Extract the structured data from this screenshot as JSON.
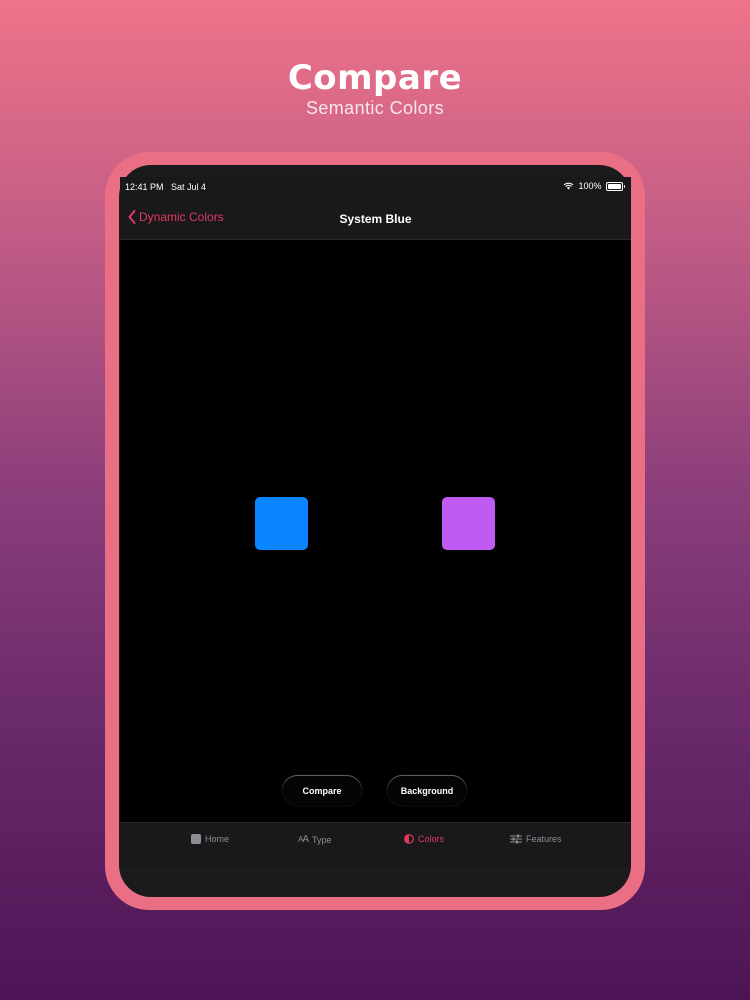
{
  "promo": {
    "title": "Compare",
    "subtitle": "Semantic Colors"
  },
  "status_bar": {
    "time": "12:41 PM",
    "date": "Sat Jul 4",
    "battery": "100%"
  },
  "nav": {
    "back_label": "Dynamic Colors",
    "title": "System Blue"
  },
  "swatches": {
    "left_color": "#0a84ff",
    "right_color": "#bf5af2"
  },
  "buttons": {
    "compare": "Compare",
    "background": "Background"
  },
  "tabs": [
    {
      "label": "Home",
      "icon": "square-icon"
    },
    {
      "label": "Type",
      "icon": "text-size-icon"
    },
    {
      "label": "Colors",
      "icon": "contrast-icon",
      "active": true
    },
    {
      "label": "Features",
      "icon": "sliders-icon"
    }
  ],
  "colors": {
    "accent": "#e0385f",
    "device_frame": "#ea6f85"
  }
}
